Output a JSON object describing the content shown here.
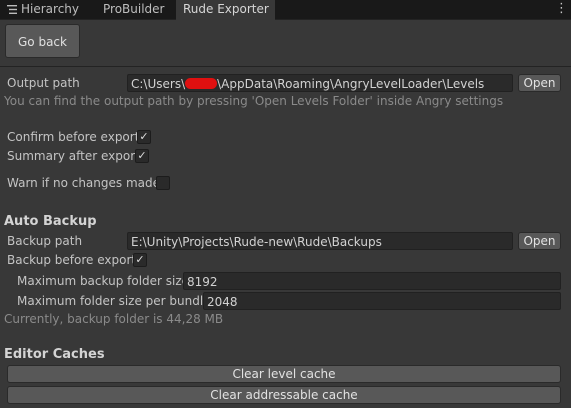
{
  "tabs": [
    {
      "label": "Hierarchy",
      "icon": "hierarchy-icon"
    },
    {
      "label": "ProBuilder"
    },
    {
      "label": "Rude Exporter",
      "active": true
    }
  ],
  "menu_icon": "kebab-menu-icon",
  "go_back_label": "Go back",
  "output": {
    "label": "Output path",
    "value_prefix": "C:\\Users\\",
    "value_suffix": "\\AppData\\Roaming\\AngryLevelLoader\\Levels",
    "open_label": "Open",
    "hint": "You can find the output path by pressing 'Open Levels Folder' inside Angry settings"
  },
  "options": {
    "confirm_label": "Confirm before export",
    "confirm_checked": true,
    "summary_label": "Summary after export",
    "summary_checked": true,
    "warn_label": "Warn if no changes made",
    "warn_checked": false
  },
  "auto_backup": {
    "title": "Auto Backup",
    "path_label": "Backup path",
    "path_value": "E:\\Unity\\Projects\\Rude-new\\Rude\\Backups",
    "open_label": "Open",
    "before_export_label": "Backup before export",
    "before_export_checked": true,
    "max_size_label": "Maximum backup folder size",
    "max_size_value": "8192",
    "max_bundle_label": "Maximum folder size per bundle",
    "max_bundle_value": "2048",
    "status": "Currently, backup folder is 44,28 MB"
  },
  "editor_caches": {
    "title": "Editor Caches",
    "clear_level_label": "Clear level cache",
    "clear_addressable_label": "Clear addressable cache"
  },
  "colors": {
    "background": "#383838",
    "tabbar": "#191919",
    "field": "#2a2a2a",
    "button": "#585858",
    "redaction": "#e01010"
  }
}
